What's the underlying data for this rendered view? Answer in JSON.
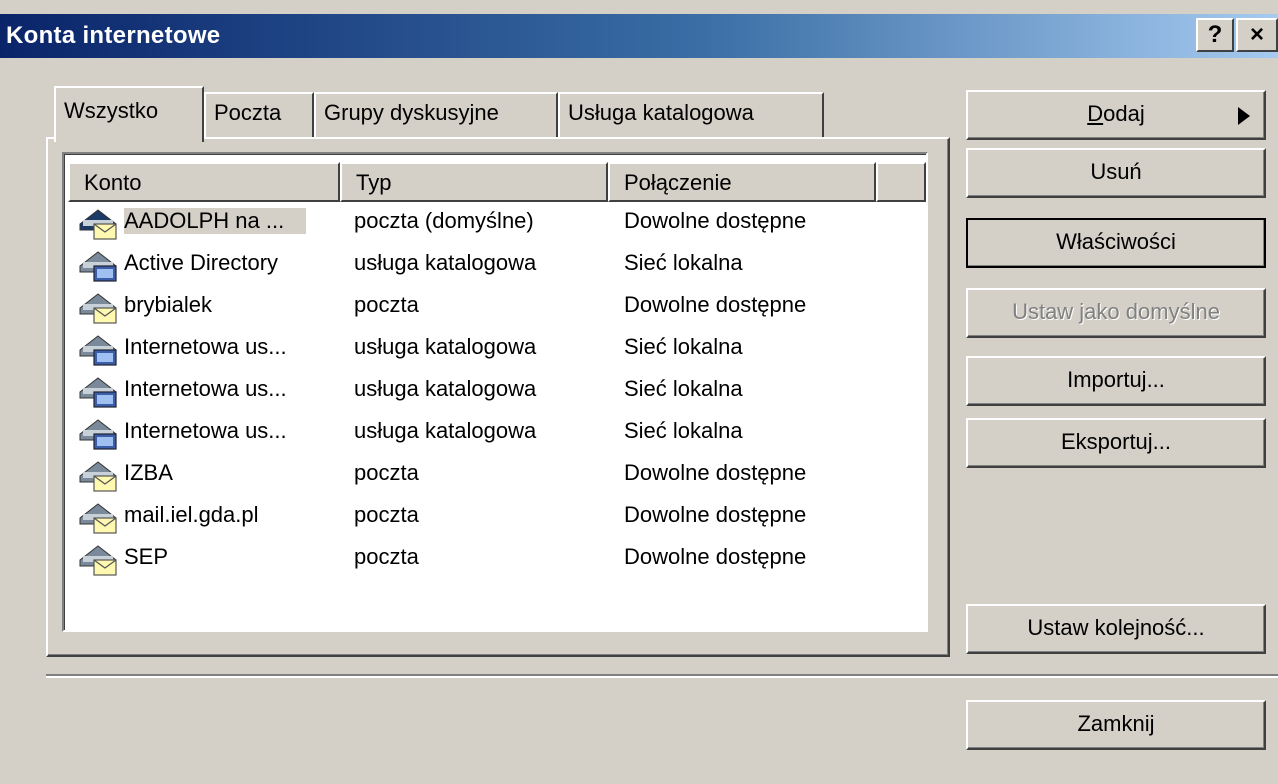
{
  "window": {
    "title": "Konta internetowe",
    "help_button": "?",
    "close_button": "×"
  },
  "tabs": [
    {
      "label": "Wszystko",
      "active": true
    },
    {
      "label": "Poczta",
      "active": false
    },
    {
      "label": "Grupy dyskusyjne",
      "active": false
    },
    {
      "label": "Usługa katalogowa",
      "active": false
    }
  ],
  "list": {
    "columns": [
      "Konto",
      "Typ",
      "Połączenie"
    ],
    "rows": [
      {
        "name": "AADOLPH na ...",
        "type": "poczta (domyślne)",
        "connection": "Dowolne dostępne",
        "icon": "mail-account-default-icon",
        "selected": true
      },
      {
        "name": "Active Directory",
        "type": "usługa katalogowa",
        "connection": "Sieć lokalna",
        "icon": "directory-service-icon",
        "selected": false
      },
      {
        "name": "brybialek",
        "type": "poczta",
        "connection": "Dowolne dostępne",
        "icon": "mail-account-icon",
        "selected": false
      },
      {
        "name": "Internetowa us...",
        "type": "usługa katalogowa",
        "connection": "Sieć lokalna",
        "icon": "directory-service-icon",
        "selected": false
      },
      {
        "name": "Internetowa us...",
        "type": "usługa katalogowa",
        "connection": "Sieć lokalna",
        "icon": "directory-service-icon",
        "selected": false
      },
      {
        "name": "Internetowa us...",
        "type": "usługa katalogowa",
        "connection": "Sieć lokalna",
        "icon": "directory-service-icon",
        "selected": false
      },
      {
        "name": "IZBA",
        "type": "poczta",
        "connection": "Dowolne dostępne",
        "icon": "mail-account-icon",
        "selected": false
      },
      {
        "name": "mail.iel.gda.pl",
        "type": "poczta",
        "connection": "Dowolne dostępne",
        "icon": "mail-account-icon",
        "selected": false
      },
      {
        "name": "SEP",
        "type": "poczta",
        "connection": "Dowolne dostępne",
        "icon": "mail-account-icon",
        "selected": false
      }
    ]
  },
  "buttons": {
    "add_accel": "D",
    "add_rest": "odaj",
    "remove": "Usuń",
    "properties": "Właściwości",
    "set_default": "Ustaw jako domyślne",
    "import": "Importuj...",
    "export": "Eksportuj...",
    "set_order": "Ustaw kolejność...",
    "close": "Zamknij"
  },
  "colors": {
    "face": "#d4d0c8",
    "title_start": "#0a246a",
    "title_end": "#a6caf0",
    "list_bg": "#ffffff",
    "disabled_text": "#808080"
  }
}
